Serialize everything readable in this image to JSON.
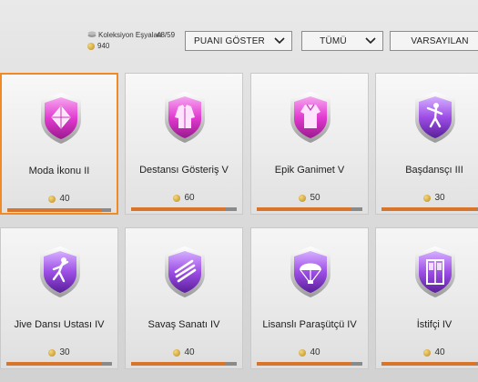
{
  "header": {
    "collection_label": "Koleksiyon Eşyaları",
    "collection_count": "48/59",
    "coins_total": "940"
  },
  "filters": {
    "points": "PUANI GÖSTER",
    "all": "TÜMÜ",
    "default": "VARSAYILAN"
  },
  "cards": [
    {
      "title": "Moda İkonu II",
      "points": "40",
      "progress": 0.9,
      "icon": "diamond-icon"
    },
    {
      "title": "Destansı Gösteriş V",
      "points": "60",
      "progress": 0.9,
      "icon": "jacket-icon"
    },
    {
      "title": "Epik Ganimet V",
      "points": "50",
      "progress": 0.9,
      "icon": "outfit-icon"
    },
    {
      "title": "Başdansçı III",
      "points": "30",
      "progress": 0.9,
      "icon": "dancer-icon"
    },
    {
      "title": "Jive Dansı Ustası IV",
      "points": "30",
      "progress": 0.9,
      "icon": "jive-dancer-icon"
    },
    {
      "title": "Savaş Sanatı IV",
      "points": "40",
      "progress": 0.9,
      "icon": "claw-icon"
    },
    {
      "title": "Lisanslı Paraşütçü IV",
      "points": "40",
      "progress": 0.9,
      "icon": "parachute-icon"
    },
    {
      "title": "İstifçi IV",
      "points": "40",
      "progress": 0.9,
      "icon": "locker-icon"
    }
  ],
  "colors": {
    "accent": "#f08a24",
    "progress_fill": "#d9742b",
    "badge_pink": "#e23bd0",
    "badge_purple": "#8e3ad8"
  }
}
